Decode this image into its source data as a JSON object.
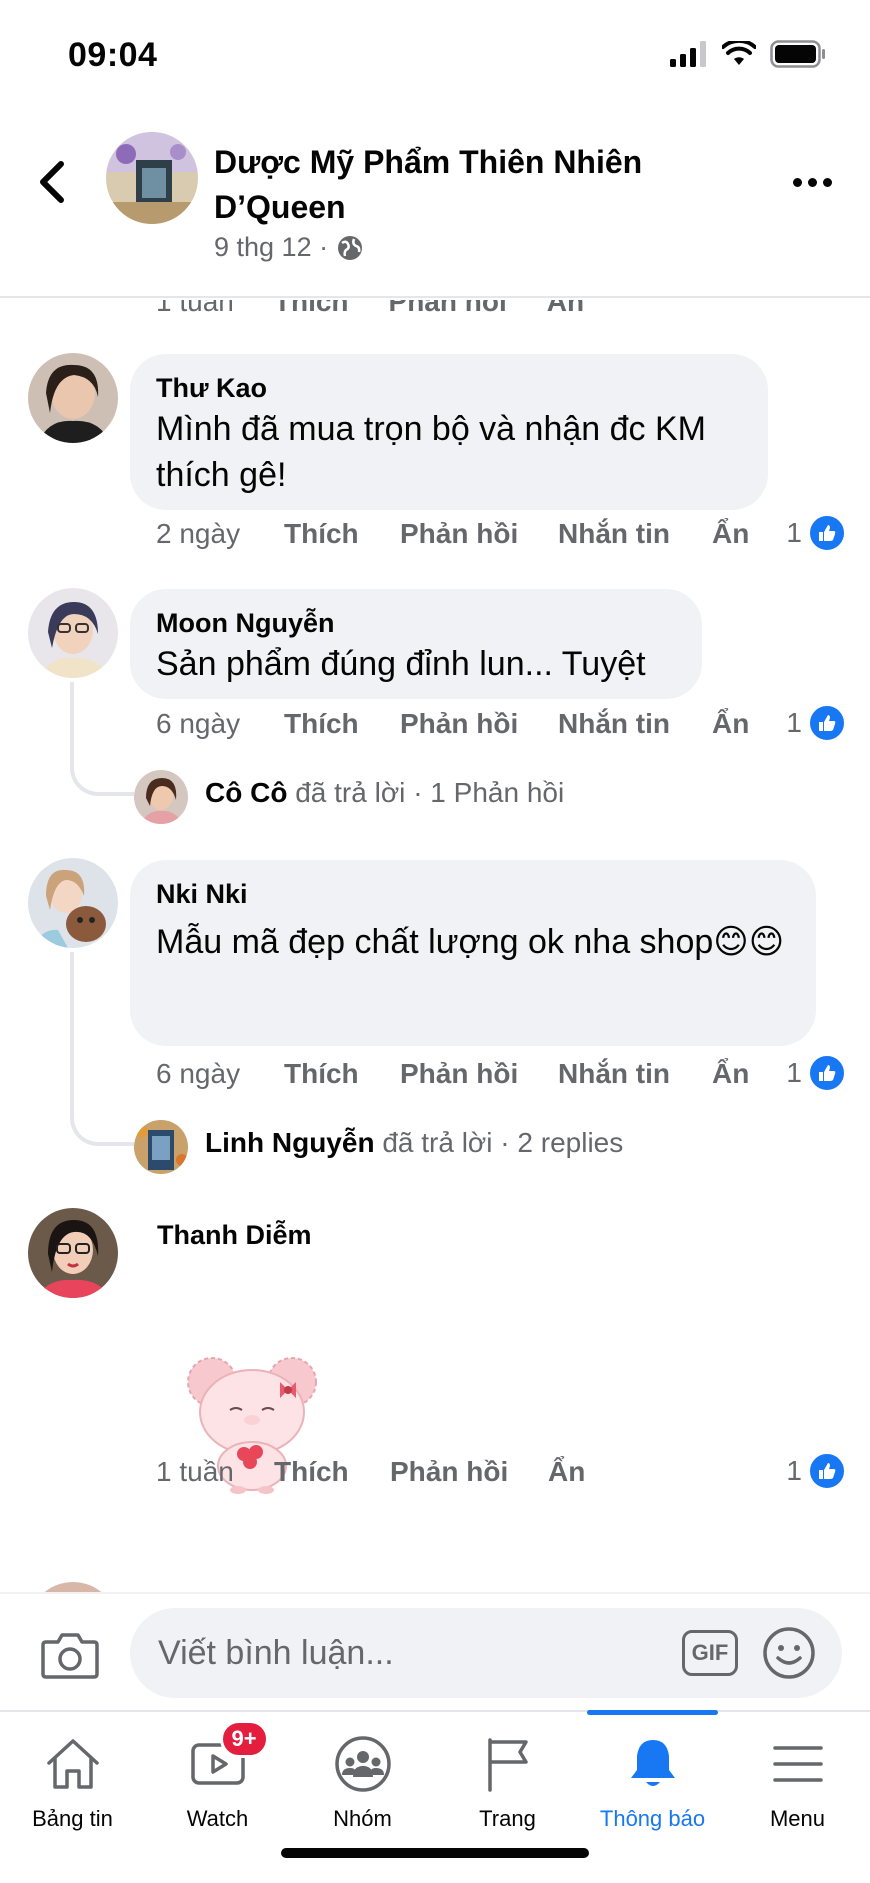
{
  "status": {
    "time": "09:04"
  },
  "header": {
    "page_name": "Dược Mỹ Phẩm Thiên Nhiên D’Queen",
    "date": "9 thg 12 ·"
  },
  "peek": {
    "time": "1 tuần",
    "like": "Thích",
    "reply": "Phản hồi",
    "hide": "Ẩn"
  },
  "comments": [
    {
      "author": "Thư Kao",
      "text": "Mình đã mua trọn bộ và nhận đc KM thích gê!",
      "time": "2 ngày",
      "like": "Thích",
      "reply": "Phản hồi",
      "message": "Nhắn tin",
      "hide": "Ẩn",
      "likes": "1"
    },
    {
      "author": "Moon Nguyễn",
      "text": "Sản phẩm đúng đỉnh lun... Tuyệt",
      "time": "6 ngày",
      "like": "Thích",
      "reply": "Phản hồi",
      "message": "Nhắn tin",
      "hide": "Ẩn",
      "likes": "1",
      "reply_summary": {
        "name": "Cô Cô",
        "action": "đã trả lời",
        "count": "· 1 Phản hồi"
      }
    },
    {
      "author": "Nki Nki",
      "text": "Mẫu mã đẹp chất lượng ok nha shop😊😊",
      "time": "6 ngày",
      "like": "Thích",
      "reply": "Phản hồi",
      "message": "Nhắn tin",
      "hide": "Ẩn",
      "likes": "1",
      "reply_summary": {
        "name": "Linh Nguyễn",
        "action": "đã trả lời",
        "count": "· 2 replies"
      }
    },
    {
      "author": "Thanh Diễm",
      "sticker": "pink-bear-sticker",
      "time": "1 tuần",
      "like": "Thích",
      "reply": "Phản hồi",
      "hide": "Ẩn",
      "likes": "1"
    }
  ],
  "composer": {
    "placeholder": "Viết bình luận...",
    "gif_label": "GIF"
  },
  "tabs": [
    {
      "label": "Bảng tin",
      "icon": "home-icon"
    },
    {
      "label": "Watch",
      "icon": "watch-icon",
      "badge": "9+"
    },
    {
      "label": "Nhóm",
      "icon": "groups-icon"
    },
    {
      "label": "Trang",
      "icon": "flag-icon"
    },
    {
      "label": "Thông báo",
      "icon": "bell-icon",
      "active": true
    },
    {
      "label": "Menu",
      "icon": "menu-icon"
    }
  ],
  "colors": {
    "accent": "#1877f2",
    "bubble": "#f0f2f5",
    "secondary_text": "#65676b",
    "badge": "#e41e3f"
  }
}
